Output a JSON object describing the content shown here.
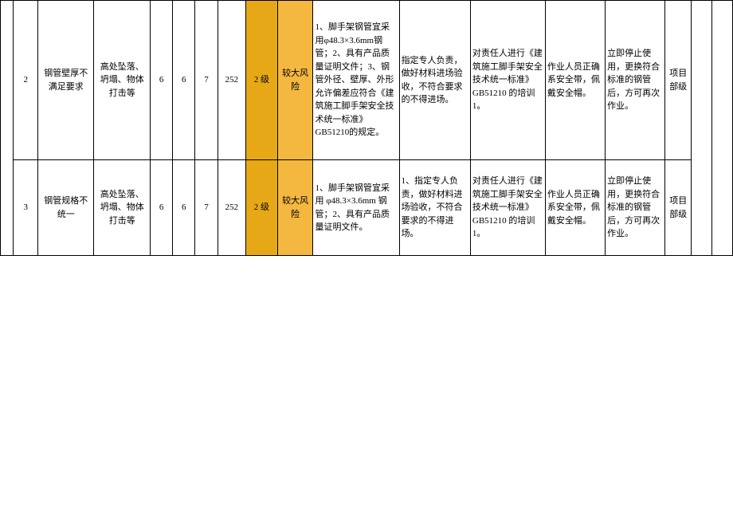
{
  "rows": [
    {
      "no": "2",
      "item": "钢管壁厚不满足要求",
      "hazard": "高处坠落、坍塌、物体打击等",
      "s1": "6",
      "s2": "6",
      "s3": "7",
      "score": "252",
      "level": "2 级",
      "risk": "较大风险",
      "measure": "1、脚手架钢管宜采用φ48.3×3.6mm钢管；2、具有产品质量证明文件；3、钢管外径、壁厚、外形允许偏差应符合《建筑施工脚手架安全技术统一标准》GB51210的规定。",
      "manage": "指定专人负责，做好材料进场验收，不符合要求的不得进场。",
      "train": "对责任人进行《建筑施工脚手架安全技术统一标准》GB51210 的培训 1。",
      "ppe": "作业人员正确系安全带，佩戴安全帽。",
      "emerg": "立即停止使用，更换符合标准的钢管后，方可再次作业。",
      "resp": "项目部级"
    },
    {
      "no": "3",
      "item": "钢管规格不统一",
      "hazard": "高处坠落、坍塌、物体打击等",
      "s1": "6",
      "s2": "6",
      "s3": "7",
      "score": "252",
      "level": "2 级",
      "risk": "较大风险",
      "measure": "1、脚手架钢管宜采用 φ48.3×3.6mm 钢管；2、具有产品质量证明文件。",
      "manage": "1、指定专人负责，做好材料进场验收，不符合要求的不得进场。",
      "train": "对责任人进行《建筑施工脚手架安全技术统一标准》GB51210 的培训 1。",
      "ppe": "作业人员正确系安全带，佩戴安全帽。",
      "emerg": "立即停止使用，更换符合标准的钢管后，方可再次作业。",
      "resp": "项目部级"
    }
  ]
}
